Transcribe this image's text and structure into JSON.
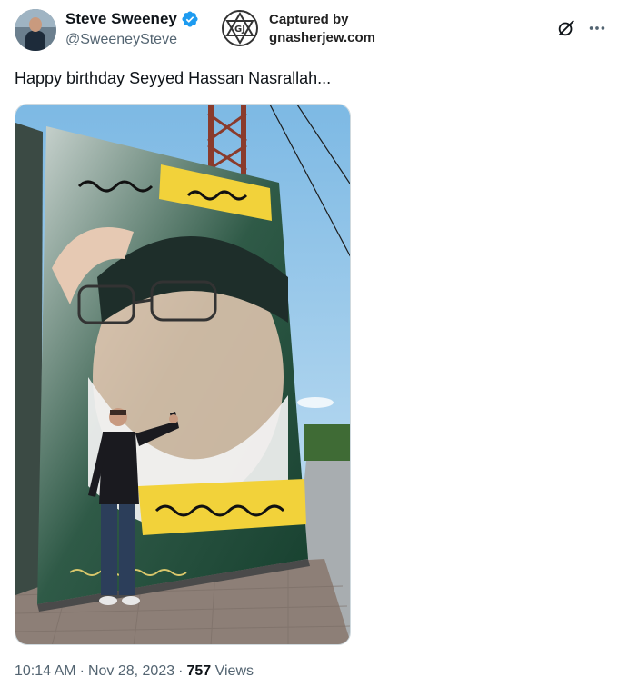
{
  "author": {
    "display_name": "Steve Sweeney",
    "handle": "@SweeneySteve"
  },
  "watermark": {
    "line1": "Captured by",
    "line2": "gnasherjew.com"
  },
  "tweet": {
    "text": "Happy birthday Seyyed Hassan Nasrallah..."
  },
  "meta": {
    "time": "10:14 AM",
    "date": "Nov 28, 2023",
    "views_count": "757",
    "views_label": "Views"
  },
  "icons": {
    "verified": "verified-badge-icon",
    "grok": "grok-icon",
    "more": "more-icon"
  },
  "colors": {
    "text": "#0f1419",
    "secondary": "#536471",
    "verified_blue": "#1d9bf0"
  }
}
